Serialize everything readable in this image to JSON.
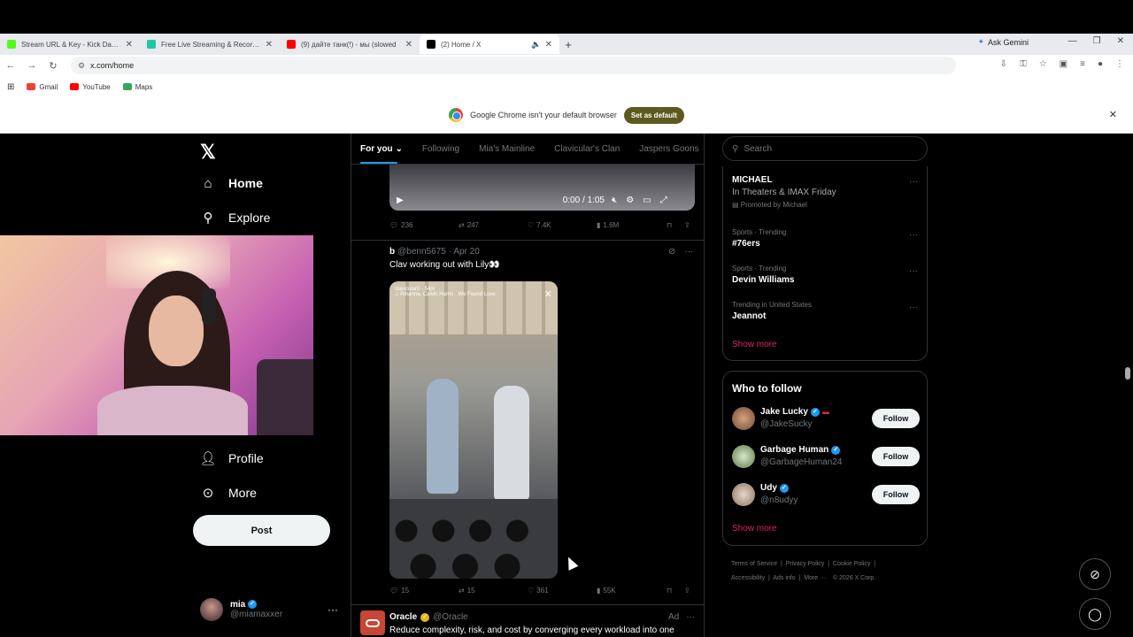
{
  "browser": {
    "tabs": [
      {
        "title": "Stream URL & Key - Kick Dashb",
        "fav_color": "#53fc18",
        "active": false
      },
      {
        "title": "Free Live Streaming & Recordin",
        "fav_color": "#1ec8a5",
        "active": false
      },
      {
        "title": "(9) дайте танк(!) - мы (slowed",
        "fav_color": "#ff0000",
        "active": false
      },
      {
        "title": "(2) Home / X",
        "fav_color": "#000000",
        "active": true
      }
    ],
    "new_tab": "+",
    "ask_gemini": "Ask Gemini",
    "url": "x.com/home",
    "bookmarks": [
      {
        "label": "Gmail",
        "color": "#ea4335"
      },
      {
        "label": "YouTube",
        "color": "#ff0000"
      },
      {
        "label": "Maps",
        "color": "#34a853"
      }
    ],
    "infobar_text": "Google Chrome isn't your default browser",
    "set_default_label": "Set as default"
  },
  "sidebar": {
    "home": "Home",
    "explore": "Explore",
    "profile": "Profile",
    "more": "More",
    "post": "Post",
    "account_name": "mia",
    "account_handle": "@miamaxxer"
  },
  "feed": {
    "tabs": [
      "For you",
      "Following",
      "Mia's Mainline",
      "Clavicular's Clan",
      "Jaspers Goons"
    ],
    "video_time": "0:00 / 1:05",
    "tweet1_stats": {
      "replies": "236",
      "reposts": "247",
      "likes": "7.4K",
      "views": "1.6M"
    },
    "tweet2": {
      "name": "b",
      "handle": "@benn5675",
      "date": "· Apr 20",
      "text": "Clav working out with Lily👀",
      "overlay_user": "clavicular0 · 54m",
      "overlay_song": "♫ Rihanna, Calvin Harris · We Found Love",
      "replies": "15",
      "reposts": "15",
      "likes": "361",
      "views": "55K"
    },
    "ad": {
      "name": "Oracle",
      "handle": "@Oracle",
      "label": "Ad",
      "text": "Reduce complexity, risk, and cost by converging every workload into one"
    }
  },
  "right": {
    "search_placeholder": "Search",
    "promo": {
      "title": "MICHAEL",
      "subtitle": "In Theaters & IMAX Friday",
      "tag": "Promoted by Michael"
    },
    "trends": [
      {
        "context": "Sports · Trending",
        "topic": "#76ers"
      },
      {
        "context": "Sports · Trending",
        "topic": "Devin Williams"
      },
      {
        "context": "Trending in United States",
        "topic": "Jeannot"
      }
    ],
    "show_more": "Show more",
    "who_to_follow": "Who to follow",
    "follow": [
      {
        "name": "Jake Lucky",
        "handle": "@JakeSucky",
        "btn": "Follow"
      },
      {
        "name": "Garbage Human",
        "handle": "@GarbageHuman24",
        "btn": "Follow"
      },
      {
        "name": "Udy",
        "handle": "@n8udyy",
        "btn": "Follow"
      }
    ],
    "footer": [
      "Terms of Service",
      "Privacy Policy",
      "Cookie Policy",
      "Accessibility",
      "Ads info",
      "More ···",
      "© 2026 X Corp."
    ]
  }
}
